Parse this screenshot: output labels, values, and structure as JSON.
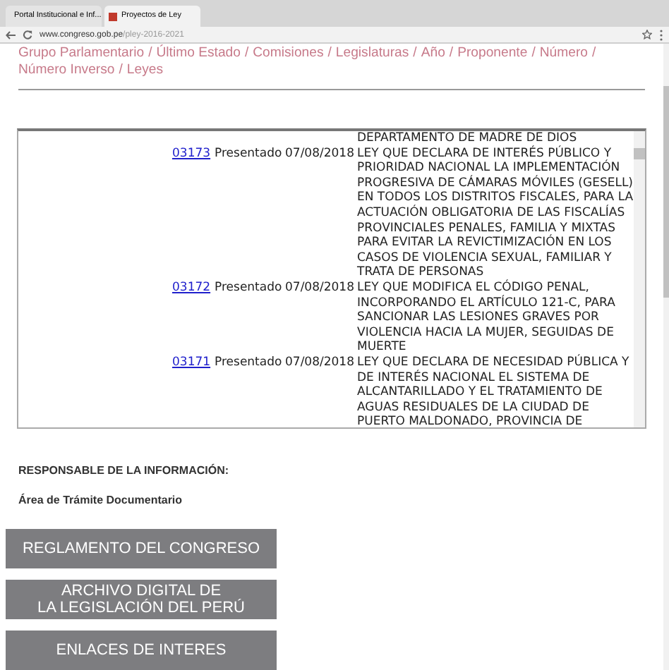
{
  "browser": {
    "tabs": [
      {
        "title": "Portal Institucional e Inf...",
        "selected": false
      },
      {
        "title": "Proyectos de Ley",
        "selected": true
      }
    ],
    "url_host": "www.congreso.gob.pe",
    "url_path": "/pley-2016-2021"
  },
  "nav_separator": "/",
  "nav_links": [
    "Grupo Parlamentario",
    "Último Estado",
    "Comisiones",
    "Legislaturas",
    "Año",
    "Proponente",
    "Número",
    "Número Inverso",
    "Leyes"
  ],
  "table": {
    "continuation": "DEPARTAMENTO DE MADRE DE DIOS",
    "rows": [
      {
        "number": "03173",
        "status": "Presentado",
        "date": "07/08/2018",
        "description": "LEY QUE DECLARA DE INTERÉS PÚBLICO Y PRIORIDAD NACIONAL LA IMPLEMENTACIÓN PROGRESIVA DE CÁMARAS MÓVILES (GESELL) EN TODOS LOS DISTRITOS FISCALES, PARA LA ACTUACIÓN OBLIGATORIA DE LAS FISCALÍAS PROVINCIALES PENALES, FAMILIA Y MIXTAS PARA EVITAR LA REVICTIMIZACIÓN EN LOS CASOS DE VIOLENCIA SEXUAL, FAMILIAR Y TRATA DE PERSONAS"
      },
      {
        "number": "03172",
        "status": "Presentado",
        "date": "07/08/2018",
        "description": "LEY QUE MODIFICA EL CÓDIGO PENAL, INCORPORANDO EL ARTÍCULO 121-C, PARA SANCIONAR LAS LESIONES GRAVES POR VIOLENCIA HACIA LA MUJER, SEGUIDAS DE MUERTE"
      },
      {
        "number": "03171",
        "status": "Presentado",
        "date": "07/08/2018",
        "description": "LEY QUE DECLARA DE NECESIDAD PÚBLICA Y DE INTERÉS NACIONAL EL SISTEMA DE ALCANTARILLADO Y EL TRATAMIENTO DE AGUAS RESIDUALES DE LA CIUDAD DE PUERTO MALDONADO, PROVINCIA DE"
      }
    ]
  },
  "responsible": {
    "label": "RESPONSABLE DE LA INFORMACIÓN:",
    "value": "Área de Trámite Documentario"
  },
  "buttons": [
    "REGLAMENTO DEL CONGRESO",
    "ARCHIVO DIGITAL DE\nLA LEGISLACIÓN DEL PERÚ",
    "ENLACES DE INTERES"
  ]
}
